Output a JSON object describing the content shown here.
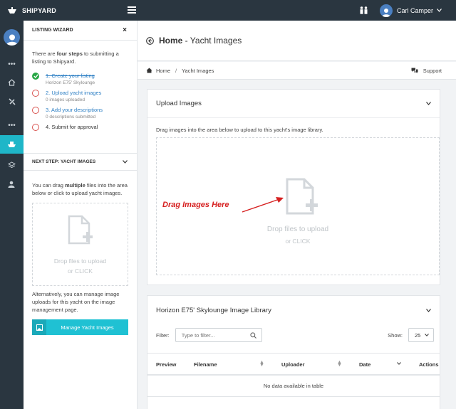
{
  "topbar": {
    "brand": "SHIPYARD",
    "user_name": "Carl Camper"
  },
  "wizard": {
    "header": "LISTING WIZARD",
    "close": "×",
    "intro_pre": "There are ",
    "intro_bold": "four steps",
    "intro_post": " to submitting a listing to Shipyard.",
    "steps": [
      {
        "title": "1. Create your listing",
        "sub": "Horizon E75' Skylounge"
      },
      {
        "title": "2. Upload yacht images",
        "sub": "0 images uploaded"
      },
      {
        "title": "3. Add your descriptions",
        "sub": "0 descriptions submitted"
      },
      {
        "title": "4. Submit for approval",
        "sub": ""
      }
    ],
    "next_step": "NEXT STEP: YACHT IMAGES",
    "drag_pre": "You can drag ",
    "drag_bold": "multiple",
    "drag_post": " files into the area below or click to upload yacht images.",
    "drop_line1": "Drop files to upload",
    "drop_line2": "or CLICK",
    "alt_text": "Alternatively, you can manage image uploads for this yacht on the image management page.",
    "manage_button": "Manage Yacht Images"
  },
  "page": {
    "title_bold": "Home",
    "title_rest": " - Yacht Images",
    "breadcrumb": [
      "Home",
      "Yacht Images"
    ],
    "breadcrumb_sep": "/",
    "support": "Support"
  },
  "upload": {
    "title": "Upload Images",
    "description": "Drag images into the area below to upload to this yacht's image library.",
    "drop_line1": "Drop files to upload",
    "drop_line2": "or CLICK",
    "annotation": "Drag Images Here"
  },
  "library": {
    "title": "Horizon E75' Skylounge Image Library",
    "filter_label": "Filter:",
    "filter_placeholder": "Type to filter...",
    "show_label": "Show:",
    "show_value": "25",
    "columns": [
      "Preview",
      "Filename",
      "Uploader",
      "Date",
      "Actions"
    ],
    "empty": "No data available in table"
  },
  "colors": {
    "sidebar_bg": "#2a3640",
    "accent": "#1fb6c8",
    "link": "#2d7fc4",
    "done": "#28a745",
    "pending": "#d9534f",
    "annotation": "#d62020"
  }
}
